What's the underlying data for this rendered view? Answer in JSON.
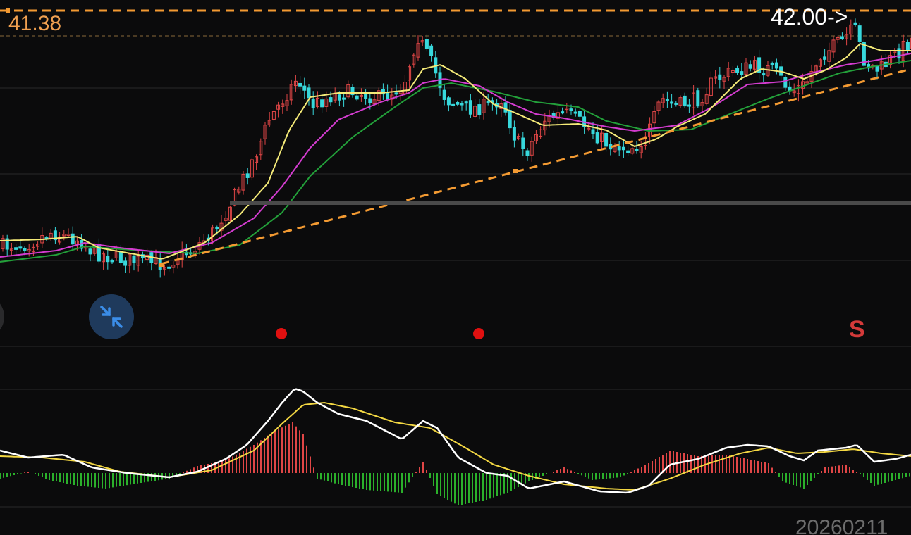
{
  "price_label": "41.38",
  "target_label": "42.00->",
  "date_label": "20260211",
  "signal_label": "S",
  "colors": {
    "background": "#0b0b0c",
    "up_candle": "#e04646",
    "down_candle": "#37d8dc",
    "ma_short": "#f4ea78",
    "ma_mid": "#d43cd0",
    "ma_long": "#23a03a",
    "trendline": "#f39a32",
    "dif_line": "#ffffff",
    "dea_line": "#f4d843",
    "macd_pos": "#e04646",
    "macd_neg": "#2bb02b",
    "signal_dot": "#e01010",
    "grid": "#2a2a2a",
    "pressure_band": "#4a4a4a"
  },
  "icons": {
    "shrink": "collapse-arrows-icon",
    "edge": "circle-button-icon"
  },
  "chart_data": [
    {
      "type": "candlestick",
      "title": "",
      "last_marked_price": 41.38,
      "target_price": 42.0,
      "overlays": [
        "moving-average-short",
        "moving-average-mid",
        "moving-average-long",
        "rising-trendline",
        "resistance-line"
      ],
      "signal_dots": 2,
      "sell_signal": "S",
      "grid": true
    },
    {
      "type": "macd",
      "lines": [
        "DIF",
        "DEA"
      ],
      "histogram": true,
      "last_date": "20260211"
    }
  ]
}
